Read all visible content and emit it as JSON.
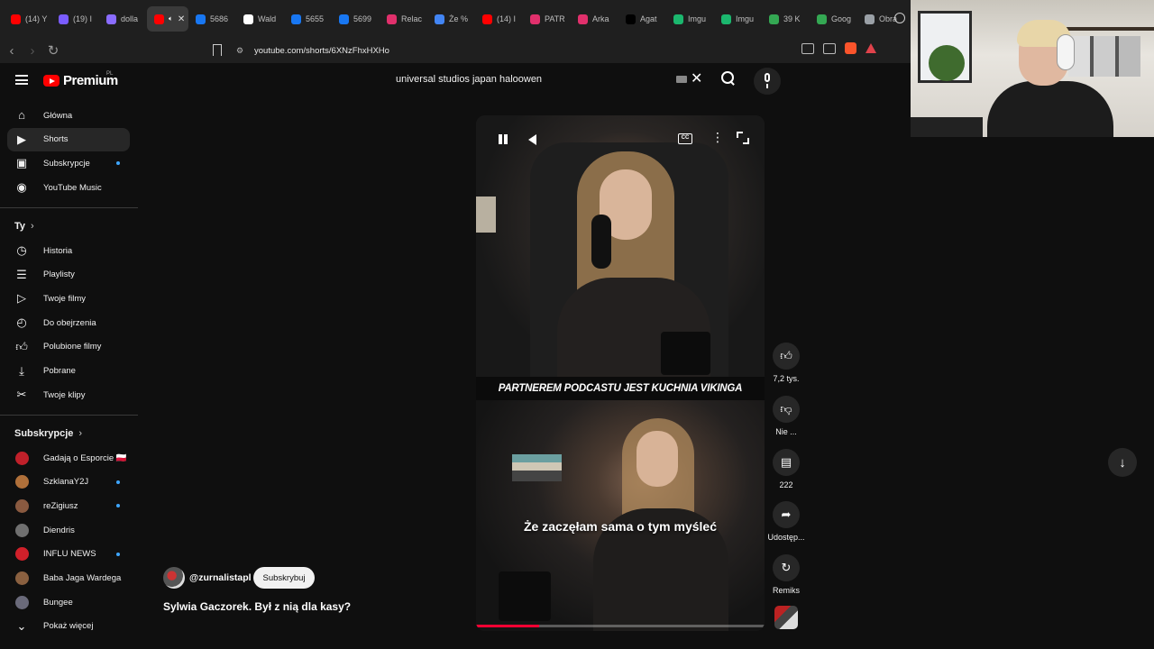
{
  "browser": {
    "tabs": [
      {
        "label": "(14) Y",
        "fav_color": "#ff0000",
        "active": false
      },
      {
        "label": "(19) I",
        "fav_color": "#7a5cff",
        "active": false
      },
      {
        "label": "dolla",
        "fav_color": "#8a6cff",
        "active": false
      },
      {
        "label": "",
        "fav_color": "#ff0000",
        "active": true
      },
      {
        "label": "5686",
        "fav_color": "#1877f2",
        "active": false
      },
      {
        "label": "Wald",
        "fav_color": "#ffffff",
        "active": false
      },
      {
        "label": "5655",
        "fav_color": "#1877f2",
        "active": false
      },
      {
        "label": "5699",
        "fav_color": "#1877f2",
        "active": false
      },
      {
        "label": "Relac",
        "fav_color": "#e1306c",
        "active": false
      },
      {
        "label": "Że %",
        "fav_color": "#4285f4",
        "active": false
      },
      {
        "label": "(14) I",
        "fav_color": "#ff0000",
        "active": false
      },
      {
        "label": "PATR",
        "fav_color": "#e1306c",
        "active": false
      },
      {
        "label": "Arka",
        "fav_color": "#e1306c",
        "active": false
      },
      {
        "label": "Agat",
        "fav_color": "#000000",
        "active": false
      },
      {
        "label": "Imgu",
        "fav_color": "#1bb76e",
        "active": false
      },
      {
        "label": "Imgu",
        "fav_color": "#1bb76e",
        "active": false
      },
      {
        "label": "39 K",
        "fav_color": "#34a853",
        "active": false
      },
      {
        "label": "Goog",
        "fav_color": "#34a853",
        "active": false
      },
      {
        "label": "Obra",
        "fav_color": "#9aa0a6",
        "active": false
      }
    ],
    "url": "youtube.com/shorts/6XNzFhxHXHo"
  },
  "youtube": {
    "logo_text": "Premium",
    "logo_region": "PL",
    "search_query": "universal studios japan haloowen",
    "sidebar": {
      "main": [
        {
          "label": "Główna",
          "icon": "home-icon",
          "active": false
        },
        {
          "label": "Shorts",
          "icon": "shorts-icon",
          "active": true
        },
        {
          "label": "Subskrypcje",
          "icon": "subscriptions-icon",
          "active": false,
          "dot": true
        },
        {
          "label": "YouTube Music",
          "icon": "music-icon",
          "active": false
        }
      ],
      "you_section": "Ty",
      "you": [
        {
          "label": "Historia",
          "icon": "history-icon"
        },
        {
          "label": "Playlisty",
          "icon": "playlist-icon"
        },
        {
          "label": "Twoje filmy",
          "icon": "your-videos-icon"
        },
        {
          "label": "Do obejrzenia",
          "icon": "watch-later-icon"
        },
        {
          "label": "Polubione filmy",
          "icon": "like-icon"
        },
        {
          "label": "Pobrane",
          "icon": "download-icon"
        },
        {
          "label": "Twoje klipy",
          "icon": "clips-icon"
        }
      ],
      "subs_section": "Subskrypcje",
      "subscriptions": [
        {
          "label": "Gadają o Esporcie 🇵🇱",
          "avatar_color": "#c0202a",
          "dot": false
        },
        {
          "label": "SzklanaY2J",
          "avatar_color": "#b0703a",
          "dot": true
        },
        {
          "label": "reZigiusz",
          "avatar_color": "#8a5a40",
          "dot": true
        },
        {
          "label": "Diendris",
          "avatar_color": "#707070",
          "dot": false
        },
        {
          "label": "INFLU NEWS",
          "avatar_color": "#d0202a",
          "dot": true
        },
        {
          "label": "Baba Jaga Wardega",
          "avatar_color": "#8a6040",
          "dot": false
        },
        {
          "label": "Bungee",
          "avatar_color": "#6a6a7a",
          "dot": false
        }
      ],
      "show_more": "Pokaż więcej"
    },
    "short": {
      "banner": "PARTNEREM PODCASTU JEST KUCHNIA VIKINGA",
      "caption": "Że zaczęłam sama o tym myśleć",
      "progress": 0.22,
      "channel": "@zurnalistapl",
      "subscribe_label": "Subskrybuj",
      "title": "Sylwia Gaczorek. Był z nią dla kasy?"
    },
    "actions": {
      "likes": "7,2 tys.",
      "dislike": "Nie ...",
      "comments": "222",
      "share": "Udostęp...",
      "remix": "Remiks"
    }
  }
}
